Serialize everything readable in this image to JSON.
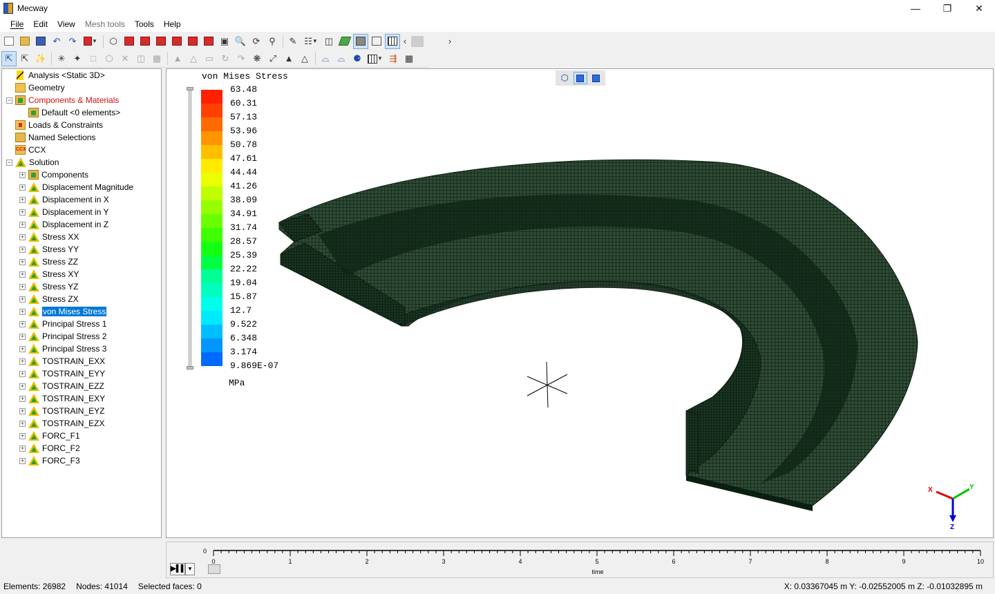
{
  "window": {
    "title": "Mecway",
    "controls": [
      "minimize",
      "maximize",
      "close"
    ]
  },
  "menu": [
    {
      "label": "File",
      "enabled": true
    },
    {
      "label": "Edit",
      "enabled": true
    },
    {
      "label": "View",
      "enabled": true
    },
    {
      "label": "Mesh tools",
      "enabled": false
    },
    {
      "label": "Tools",
      "enabled": true
    },
    {
      "label": "Help",
      "enabled": true
    }
  ],
  "tree": [
    {
      "label": "Analysis <Static 3D>",
      "icon": "analysis-icon",
      "level": 0,
      "expander": "none"
    },
    {
      "label": "Geometry",
      "icon": "folder-icon",
      "level": 0,
      "expander": "none"
    },
    {
      "label": "Components & Materials",
      "icon": "component-icon",
      "level": 0,
      "expander": "minus",
      "color": "red"
    },
    {
      "label": "Default <0 elements>",
      "icon": "component-icon",
      "level": 1,
      "expander": "none"
    },
    {
      "label": "Loads & Constraints",
      "icon": "loads-icon",
      "level": 0,
      "expander": "none"
    },
    {
      "label": "Named Selections",
      "icon": "named-selection-icon",
      "level": 0,
      "expander": "none"
    },
    {
      "label": "CCX",
      "icon": "ccx-icon",
      "level": 0,
      "expander": "none"
    },
    {
      "label": "Solution",
      "icon": "solution-icon",
      "level": 0,
      "expander": "minus"
    },
    {
      "label": "Components",
      "icon": "component-icon",
      "level": 1,
      "expander": "plus"
    },
    {
      "label": "Displacement Magnitude",
      "icon": "result-icon",
      "level": 1,
      "expander": "plus"
    },
    {
      "label": "Displacement in X",
      "icon": "result-icon",
      "level": 1,
      "expander": "plus"
    },
    {
      "label": "Displacement in Y",
      "icon": "result-icon",
      "level": 1,
      "expander": "plus"
    },
    {
      "label": "Displacement in Z",
      "icon": "result-icon",
      "level": 1,
      "expander": "plus"
    },
    {
      "label": "Stress XX",
      "icon": "result-icon",
      "level": 1,
      "expander": "plus"
    },
    {
      "label": "Stress YY",
      "icon": "result-icon",
      "level": 1,
      "expander": "plus"
    },
    {
      "label": "Stress ZZ",
      "icon": "result-icon",
      "level": 1,
      "expander": "plus"
    },
    {
      "label": "Stress XY",
      "icon": "result-icon",
      "level": 1,
      "expander": "plus"
    },
    {
      "label": "Stress YZ",
      "icon": "result-icon",
      "level": 1,
      "expander": "plus"
    },
    {
      "label": "Stress ZX",
      "icon": "result-icon",
      "level": 1,
      "expander": "plus"
    },
    {
      "label": "von Mises Stress",
      "icon": "result-icon",
      "level": 1,
      "expander": "plus",
      "selected": true
    },
    {
      "label": "Principal Stress 1",
      "icon": "result-icon",
      "level": 1,
      "expander": "plus"
    },
    {
      "label": "Principal Stress 2",
      "icon": "result-icon",
      "level": 1,
      "expander": "plus"
    },
    {
      "label": "Principal Stress 3",
      "icon": "result-icon",
      "level": 1,
      "expander": "plus"
    },
    {
      "label": "TOSTRAIN_EXX",
      "icon": "result-icon",
      "level": 1,
      "expander": "plus"
    },
    {
      "label": "TOSTRAIN_EYY",
      "icon": "result-icon",
      "level": 1,
      "expander": "plus"
    },
    {
      "label": "TOSTRAIN_EZZ",
      "icon": "result-icon",
      "level": 1,
      "expander": "plus"
    },
    {
      "label": "TOSTRAIN_EXY",
      "icon": "result-icon",
      "level": 1,
      "expander": "plus"
    },
    {
      "label": "TOSTRAIN_EYZ",
      "icon": "result-icon",
      "level": 1,
      "expander": "plus"
    },
    {
      "label": "TOSTRAIN_EZX",
      "icon": "result-icon",
      "level": 1,
      "expander": "plus"
    },
    {
      "label": "FORC_F1",
      "icon": "result-icon",
      "level": 1,
      "expander": "plus"
    },
    {
      "label": "FORC_F2",
      "icon": "result-icon",
      "level": 1,
      "expander": "plus"
    },
    {
      "label": "FORC_F3",
      "icon": "result-icon",
      "level": 1,
      "expander": "plus"
    }
  ],
  "legend": {
    "title": "von Mises Stress",
    "units": "MPa",
    "values": [
      "63.48",
      "60.31",
      "57.13",
      "53.96",
      "50.78",
      "47.61",
      "44.44",
      "41.26",
      "38.09",
      "34.91",
      "31.74",
      "28.57",
      "25.39",
      "22.22",
      "19.04",
      "15.87",
      "12.7",
      "9.522",
      "6.348",
      "3.174",
      "9.869E-07"
    ],
    "colors": [
      "#ff2000",
      "#ff4000",
      "#ff6a00",
      "#ff9500",
      "#ffbf00",
      "#ffea00",
      "#eaff00",
      "#bfff00",
      "#95ff00",
      "#6aff00",
      "#40ff00",
      "#15ff15",
      "#00ff40",
      "#00ff95",
      "#00ffbf",
      "#00ffea",
      "#00eaff",
      "#00bfff",
      "#0095ff",
      "#006aff",
      "#0015ff"
    ]
  },
  "axis_triad": {
    "x": "X",
    "y": "Y",
    "z": "Z",
    "colors": {
      "x": "#e00000",
      "y": "#00c000",
      "z": "#0000e0"
    }
  },
  "mesh_color": "#0f2a18",
  "timeline": {
    "ticks": [
      "0",
      "1",
      "2",
      "3",
      "4",
      "5",
      "6",
      "7",
      "8",
      "9",
      "10"
    ],
    "start_label": "0",
    "axis_label": "time",
    "play_label": "▶▌▌",
    "dropdown_label": "▼"
  },
  "status": {
    "elements": "Elements: 26982",
    "nodes": "Nodes: 41014",
    "selected": "Selected faces: 0",
    "coords": "X: 0.03367045 m Y: -0.02552005 m Z: -0.01032895 m"
  }
}
